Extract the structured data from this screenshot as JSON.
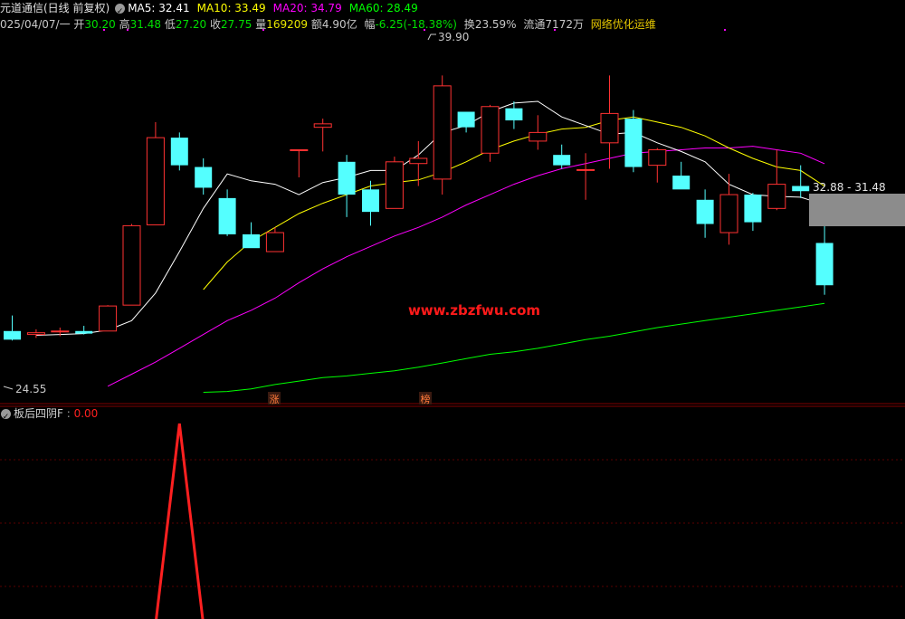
{
  "header": {
    "title": "元道通信(日线 前复权)",
    "ma_lines": [
      {
        "label": "MA5: 32.41",
        "color": "#ffffff"
      },
      {
        "label": "MA10: 33.49",
        "color": "#ffff00"
      },
      {
        "label": "MA20: 34.79",
        "color": "#ff00ff"
      },
      {
        "label": "MA60: 28.49",
        "color": "#00ff00"
      }
    ]
  },
  "quote": {
    "date": "025/04/07/一",
    "open_label": "开",
    "open": "30.20",
    "high_label": "高",
    "high": "31.48",
    "low_label": "低",
    "low": "27.20",
    "close_label": "收",
    "close": "27.75",
    "vol_label": "量",
    "vol": "169209",
    "amount_label": "额",
    "amount": "4.90亿",
    "change_label": "幅",
    "change": "-6.25(-18.38%)",
    "turnover_label": "换",
    "turnover": "23.59%",
    "float_label": "流通",
    "float": "7172万",
    "sector": "网络优化运维"
  },
  "annotations": {
    "high_mark": "39.90",
    "low_mark": "24.55",
    "range_box": "32.88 - 31.48",
    "watermark": "www.zbzfwu.com",
    "tag1": "涨",
    "tag2": "榜"
  },
  "indicator": {
    "name": "板后四阴F",
    "value": "0.00"
  },
  "colors": {
    "up": "#ff3232",
    "down": "#54ffff",
    "ma5": "#ffffff",
    "ma10": "#ffff00",
    "ma20": "#ff00ff",
    "ma60": "#00ff00",
    "indicator": "#ff2020",
    "grid": "#800000"
  },
  "chart_data": {
    "type": "candlestick",
    "price_range": [
      21.0,
      42.7
    ],
    "candles": [
      {
        "o": 25.1,
        "h": 26.0,
        "l": 24.55,
        "c": 24.6
      },
      {
        "o": 24.9,
        "h": 25.2,
        "l": 24.7,
        "c": 25.0
      },
      {
        "o": 25.05,
        "h": 25.3,
        "l": 24.8,
        "c": 25.1
      },
      {
        "o": 25.1,
        "h": 25.4,
        "l": 24.9,
        "c": 24.95
      },
      {
        "o": 25.1,
        "h": 26.6,
        "l": 25.1,
        "c": 26.55
      },
      {
        "o": 26.6,
        "h": 31.3,
        "l": 26.6,
        "c": 31.2
      },
      {
        "o": 31.25,
        "h": 37.2,
        "l": 31.25,
        "c": 36.3
      },
      {
        "o": 36.3,
        "h": 36.6,
        "l": 34.4,
        "c": 34.7
      },
      {
        "o": 34.6,
        "h": 35.1,
        "l": 33.0,
        "c": 33.4
      },
      {
        "o": 32.8,
        "h": 33.3,
        "l": 30.6,
        "c": 30.7
      },
      {
        "o": 30.7,
        "h": 31.4,
        "l": 30.3,
        "c": 29.9
      },
      {
        "o": 29.7,
        "h": 31.1,
        "l": 29.8,
        "c": 30.8
      },
      {
        "o": 35.6,
        "h": 35.6,
        "l": 34.0,
        "c": 35.6
      },
      {
        "o": 36.9,
        "h": 37.4,
        "l": 35.5,
        "c": 37.1
      },
      {
        "o": 34.9,
        "h": 35.3,
        "l": 31.7,
        "c": 33.0
      },
      {
        "o": 33.3,
        "h": 33.8,
        "l": 31.2,
        "c": 32.0
      },
      {
        "o": 32.2,
        "h": 35.2,
        "l": 32.2,
        "c": 34.9
      },
      {
        "o": 34.8,
        "h": 36.1,
        "l": 33.5,
        "c": 35.1
      },
      {
        "o": 33.9,
        "h": 39.9,
        "l": 33.0,
        "c": 39.3
      },
      {
        "o": 37.8,
        "h": 37.8,
        "l": 36.6,
        "c": 36.9
      },
      {
        "o": 35.4,
        "h": 38.2,
        "l": 34.9,
        "c": 38.1
      },
      {
        "o": 38.0,
        "h": 38.4,
        "l": 36.8,
        "c": 37.3
      },
      {
        "o": 36.1,
        "h": 37.6,
        "l": 35.6,
        "c": 36.6
      },
      {
        "o": 35.3,
        "h": 35.9,
        "l": 34.5,
        "c": 34.7
      },
      {
        "o": 34.45,
        "h": 35.4,
        "l": 32.7,
        "c": 34.45
      },
      {
        "o": 36.0,
        "h": 39.9,
        "l": 34.5,
        "c": 37.7
      },
      {
        "o": 37.4,
        "h": 37.9,
        "l": 34.3,
        "c": 34.6
      },
      {
        "o": 34.7,
        "h": 35.7,
        "l": 33.7,
        "c": 35.6
      },
      {
        "o": 34.1,
        "h": 34.9,
        "l": 33.6,
        "c": 33.3
      },
      {
        "o": 32.7,
        "h": 33.3,
        "l": 30.5,
        "c": 31.3
      },
      {
        "o": 30.8,
        "h": 34.2,
        "l": 30.1,
        "c": 33.0
      },
      {
        "o": 33.0,
        "h": 33.1,
        "l": 30.9,
        "c": 31.4
      },
      {
        "o": 32.2,
        "h": 35.6,
        "l": 32.1,
        "c": 33.6
      },
      {
        "o": 33.5,
        "h": 34.7,
        "l": 32.8,
        "c": 33.2
      },
      {
        "o": 30.2,
        "h": 31.48,
        "l": 27.2,
        "c": 27.75
      }
    ],
    "ma5": [
      null,
      24.85,
      24.9,
      24.95,
      25.15,
      25.7,
      27.3,
      29.7,
      32.2,
      34.2,
      33.8,
      33.6,
      33.0,
      33.7,
      34.0,
      34.4,
      34.4,
      35.3,
      36.6,
      37.0,
      37.8,
      38.3,
      38.4,
      37.5,
      37.0,
      36.5,
      36.6,
      36.0,
      35.5,
      34.9,
      33.6,
      33.0,
      32.9,
      32.85,
      32.41
    ],
    "ma10": [
      null,
      null,
      null,
      null,
      null,
      null,
      null,
      null,
      27.5,
      29.1,
      30.3,
      31.1,
      31.9,
      32.5,
      33.0,
      33.5,
      33.7,
      33.85,
      34.3,
      34.9,
      35.6,
      36.1,
      36.5,
      36.8,
      36.9,
      37.3,
      37.5,
      37.2,
      36.9,
      36.4,
      35.7,
      35.1,
      34.6,
      34.4,
      33.49
    ],
    "ma20": [
      null,
      null,
      null,
      null,
      21.9,
      22.6,
      23.3,
      24.1,
      24.9,
      25.7,
      26.3,
      27.0,
      27.9,
      28.7,
      29.4,
      30.0,
      30.6,
      31.1,
      31.7,
      32.4,
      33.0,
      33.6,
      34.1,
      34.5,
      34.8,
      35.1,
      35.4,
      35.5,
      35.6,
      35.7,
      35.7,
      35.8,
      35.6,
      35.4,
      34.79
    ],
    "ma60": [
      null,
      null,
      null,
      null,
      null,
      null,
      null,
      null,
      21.55,
      21.6,
      21.75,
      22.0,
      22.2,
      22.4,
      22.5,
      22.65,
      22.8,
      23.0,
      23.25,
      23.5,
      23.75,
      23.9,
      24.1,
      24.35,
      24.6,
      24.8,
      25.05,
      25.3,
      25.5,
      25.7,
      25.9,
      26.1,
      26.3,
      26.5,
      26.7
    ],
    "indicator_values": [
      0,
      0,
      0,
      0,
      0,
      0,
      0,
      1,
      0,
      0,
      0,
      0,
      0,
      0,
      0,
      0,
      0,
      0,
      0,
      0,
      0,
      0,
      0,
      0,
      0,
      0,
      0,
      0,
      0,
      0,
      0,
      0,
      0,
      0,
      0
    ]
  }
}
